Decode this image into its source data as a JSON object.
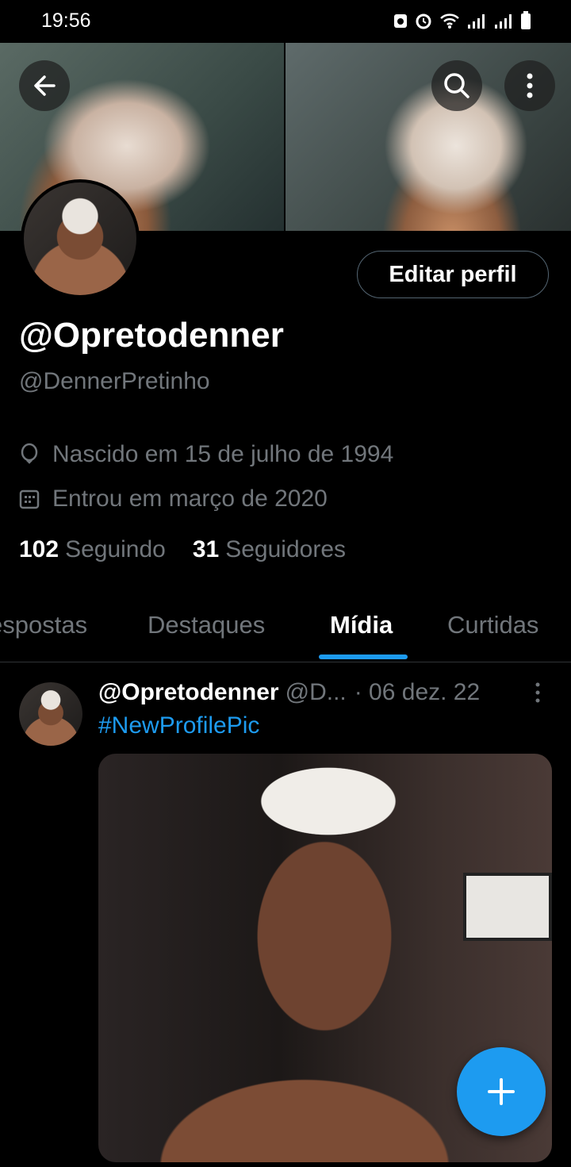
{
  "status_bar": {
    "time": "19:56"
  },
  "profile": {
    "display_name": "@Opretodenner",
    "handle": "@DennerPretinho",
    "birth": "Nascido em 15 de julho de 1994",
    "joined": "Entrou em março de 2020",
    "following_count": "102",
    "following_label": "Seguindo",
    "followers_count": "31",
    "followers_label": "Seguidores",
    "edit_label": "Editar perfil"
  },
  "tabs": [
    {
      "label": "espostas",
      "active": false
    },
    {
      "label": "Destaques",
      "active": false
    },
    {
      "label": "Mídia",
      "active": true
    },
    {
      "label": "Curtidas",
      "active": false
    }
  ],
  "tweet": {
    "author": "@Opretodenner",
    "handle": "@D...",
    "date": "· 06 dez. 22",
    "text": "#NewProfilePic"
  },
  "colors": {
    "accent": "#1d9bf0",
    "muted": "#71767b",
    "background": "#000000"
  },
  "icons": [
    "back-arrow-icon",
    "search-icon",
    "more-vertical-icon",
    "location-pin-icon",
    "calendar-icon",
    "plus-icon"
  ]
}
